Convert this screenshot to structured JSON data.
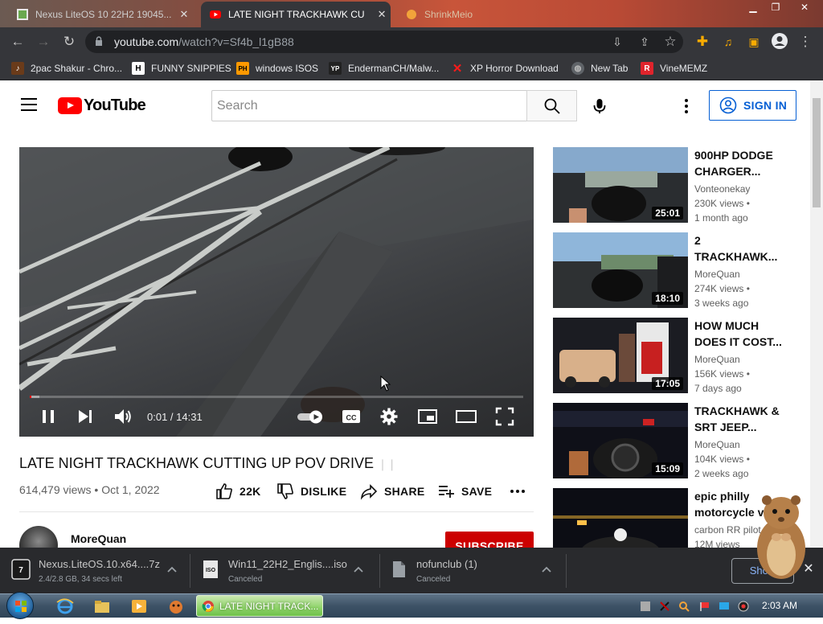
{
  "browser": {
    "tabs": [
      {
        "label": "Nexus LiteOS 10 22H2 19045...",
        "active": false
      },
      {
        "label": "LATE NIGHT TRACKHAWK CU",
        "active": true
      },
      {
        "label": "ShrinkMeio",
        "active": false
      }
    ],
    "url_host": "youtube.com",
    "url_path": "/watch?v=Sf4b_l1gB88",
    "bookmarks": [
      {
        "label": "2pac Shakur - Chro...",
        "icon": "music-icon",
        "color": "#d35400"
      },
      {
        "label": "FUNNY SNIPPIES",
        "icon": "h-icon",
        "color": "#ffffff"
      },
      {
        "label": "windows ISOS",
        "icon": "ph-icon",
        "color": "#ff9900"
      },
      {
        "label": "EndermanCH/Malw...",
        "icon": "yp-icon",
        "color": "#333333"
      },
      {
        "label": "XP Horror Download",
        "icon": "x-icon",
        "color": "#ff1a1a"
      },
      {
        "label": "New Tab",
        "icon": "globe-icon",
        "color": "#9aa0a6"
      },
      {
        "label": "VineMEMZ",
        "icon": "r-icon",
        "color": "#e0242c"
      }
    ]
  },
  "header": {
    "logo_text": "YouTube",
    "search_placeholder": "Search",
    "signin_label": "SIGN IN"
  },
  "player": {
    "time_current": "0:01",
    "time_separator": " / ",
    "time_total": "14:31",
    "progress_fraction": 0.0011,
    "buffered_fraction": 0.02
  },
  "video": {
    "title": "LATE NIGHT TRACKHAWK CUTTING UP POV DRIVE",
    "views": "614,479 views",
    "date": "Oct 1, 2022",
    "meta_separator": " • ",
    "like_count": "22K",
    "dislike_label": "DISLIKE",
    "share_label": "SHARE",
    "save_label": "SAVE",
    "channel_name": "MoreQuan",
    "subscribe_label": "SUBSCRIBE"
  },
  "recommendations": [
    {
      "title_line1": "900HP DODGE",
      "title_line2": "CHARGER...",
      "channel": "Vonteonekay",
      "views": "230K views •",
      "age": "1 month ago",
      "duration": "25:01"
    },
    {
      "title_line1": "2",
      "title_line2": "TRACKHAWK...",
      "channel": "MoreQuan",
      "views": "274K views •",
      "age": "3 weeks ago",
      "duration": "18:10"
    },
    {
      "title_line1": "HOW MUCH",
      "title_line2": "DOES IT COST...",
      "channel": "MoreQuan",
      "views": "156K views •",
      "age": "7 days ago",
      "duration": "17:05"
    },
    {
      "title_line1": "TRACKHAWK &",
      "title_line2": "SRT JEEP...",
      "channel": "MoreQuan",
      "views": "104K views •",
      "age": "2 weeks ago",
      "duration": "15:09"
    },
    {
      "title_line1": "epic philly",
      "title_line2": "motorcycle vs",
      "channel": "carbon RR pilot",
      "views": "12M views",
      "age": "",
      "duration": ""
    }
  ],
  "downloads": [
    {
      "name": "Nexus.LiteOS.10.x64....7z",
      "status": "2.4/2.8 GB, 34 secs left"
    },
    {
      "name": "Win11_22H2_Englis....iso",
      "status": "Canceled"
    },
    {
      "name": "nofunclub (1)",
      "status": "Canceled"
    }
  ],
  "downloads_show_all": "Show",
  "taskbar": {
    "chrome_task_label": "LATE NIGHT TRACK...",
    "clock": "2:03 AM"
  }
}
